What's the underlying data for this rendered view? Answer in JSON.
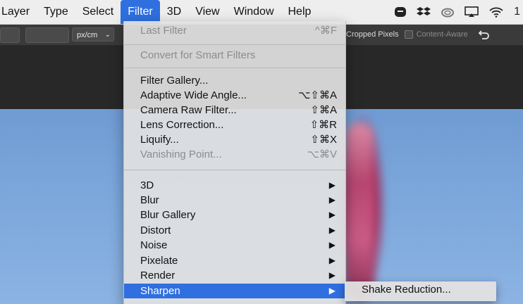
{
  "menubar": {
    "items": [
      "Layer",
      "Type",
      "Select",
      "Filter",
      "3D",
      "View",
      "Window",
      "Help"
    ],
    "active_index": 3,
    "status_icons": [
      "dashlane-icon",
      "dropbox-icon",
      "creative-cloud-icon",
      "airplay-icon",
      "wifi-icon"
    ],
    "status_text": "1"
  },
  "options_bar": {
    "unit": "px/cm",
    "cropped_pixels": "Cropped Pixels",
    "content_aware": "Content-Aware"
  },
  "filter_menu": {
    "last_filter": {
      "label": "Last Filter",
      "shortcut": "^⌘F",
      "disabled": true
    },
    "convert": {
      "label": "Convert for Smart Filters",
      "disabled": true
    },
    "group1": [
      {
        "label": "Filter Gallery...",
        "shortcut": ""
      },
      {
        "label": "Adaptive Wide Angle...",
        "shortcut": "⌥⇧⌘A"
      },
      {
        "label": "Camera Raw Filter...",
        "shortcut": "⇧⌘A"
      },
      {
        "label": "Lens Correction...",
        "shortcut": "⇧⌘R"
      },
      {
        "label": "Liquify...",
        "shortcut": "⇧⌘X"
      },
      {
        "label": "Vanishing Point...",
        "shortcut": "⌥⌘V",
        "disabled": true
      }
    ],
    "group2": [
      {
        "label": "3D"
      },
      {
        "label": "Blur"
      },
      {
        "label": "Blur Gallery"
      },
      {
        "label": "Distort"
      },
      {
        "label": "Noise"
      },
      {
        "label": "Pixelate"
      },
      {
        "label": "Render"
      },
      {
        "label": "Sharpen",
        "highlighted": true
      }
    ],
    "submenu_arrow": "▶"
  },
  "submenu": {
    "items": [
      "Shake Reduction..."
    ]
  },
  "colors": {
    "highlight": "#2f6fe0"
  }
}
